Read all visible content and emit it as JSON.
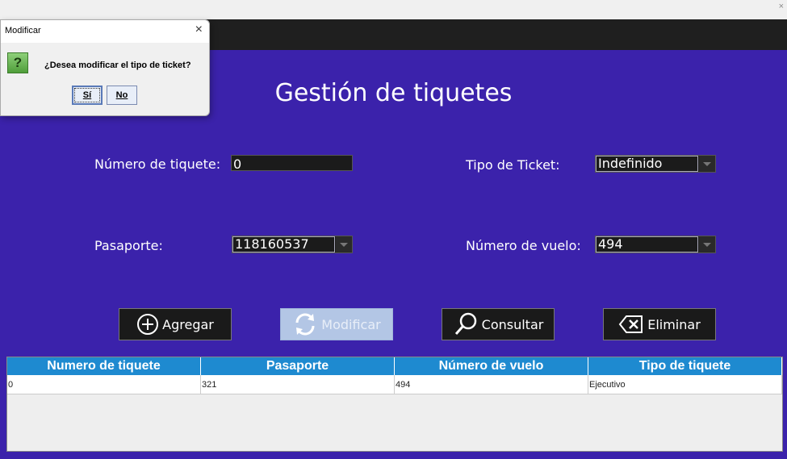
{
  "window": {
    "close_glyph": "×"
  },
  "form": {
    "title": "Gestión de tiquetes",
    "ticket_number_label": "Número de tiquete:",
    "ticket_number_value": "0",
    "ticket_type_label": "Tipo de Ticket:",
    "ticket_type_value": "Indefinido",
    "passport_label": "Pasaporte:",
    "passport_value": "118160537",
    "flight_number_label": "Número de vuelo:",
    "flight_number_value": "494"
  },
  "buttons": {
    "add": "Agregar",
    "modify": "Modificar",
    "query": "Consultar",
    "delete": "Eliminar"
  },
  "table": {
    "headers": [
      "Numero de tiquete",
      "Pasaporte",
      "Número de vuelo",
      "Tipo de tiquete"
    ],
    "rows": [
      [
        "0",
        "321",
        "494",
        "Ejecutivo"
      ]
    ]
  },
  "dialog": {
    "title": "Modificar",
    "close_glyph": "×",
    "icon_glyph": "?",
    "message": "¿Desea modificar el tipo de ticket?",
    "yes": "Sí",
    "no": "No"
  },
  "colors": {
    "background": "#3b22ab",
    "table_header": "#1e8ad0",
    "button": "#1a1a1a"
  }
}
